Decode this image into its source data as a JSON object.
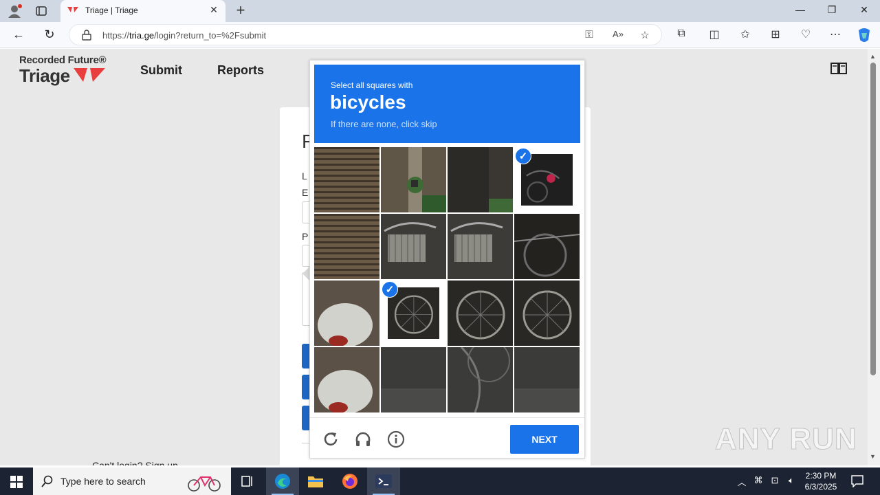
{
  "browser": {
    "tab_title": "Triage | Triage",
    "url_prefix": "https://",
    "url_host": "tria.ge",
    "url_path": "/login?return_to=%2Fsubmit"
  },
  "site": {
    "logo_line1": "Recorded Future®",
    "logo_line2": "Triage",
    "nav": [
      "Submit",
      "Reports"
    ]
  },
  "login_card": {
    "title_fragment": "F",
    "label1_fragment": "L",
    "label2_fragment": "E",
    "label3_fragment": "P",
    "bottom_links": "Can't login?       Sign up"
  },
  "captcha": {
    "instruction": "Select all squares with",
    "target": "bicycles",
    "subtext": "If there are none, click skip",
    "next_label": "NEXT",
    "tiles": [
      {
        "row": 0,
        "col": 0,
        "selected": false,
        "scene": "shutter-wall"
      },
      {
        "row": 0,
        "col": 1,
        "selected": false,
        "scene": "doorway-plant"
      },
      {
        "row": 0,
        "col": 2,
        "selected": false,
        "scene": "dark-wall"
      },
      {
        "row": 0,
        "col": 3,
        "selected": true,
        "scene": "bicycle-seat"
      },
      {
        "row": 1,
        "col": 0,
        "selected": false,
        "scene": "shutter-wall"
      },
      {
        "row": 1,
        "col": 1,
        "selected": false,
        "scene": "bicycle-basket"
      },
      {
        "row": 1,
        "col": 2,
        "selected": false,
        "scene": "bicycle-basket"
      },
      {
        "row": 1,
        "col": 3,
        "selected": false,
        "scene": "bicycles-dark"
      },
      {
        "row": 2,
        "col": 0,
        "selected": false,
        "scene": "scooter"
      },
      {
        "row": 2,
        "col": 1,
        "selected": true,
        "scene": "bicycle-wheel"
      },
      {
        "row": 2,
        "col": 2,
        "selected": false,
        "scene": "bicycle-wheel"
      },
      {
        "row": 2,
        "col": 3,
        "selected": false,
        "scene": "bicycle-wheel"
      },
      {
        "row": 3,
        "col": 0,
        "selected": false,
        "scene": "scooter"
      },
      {
        "row": 3,
        "col": 1,
        "selected": false,
        "scene": "pavement"
      },
      {
        "row": 3,
        "col": 2,
        "selected": false,
        "scene": "pavement-wheel"
      },
      {
        "row": 3,
        "col": 3,
        "selected": false,
        "scene": "pavement"
      }
    ],
    "colors": {
      "header": "#1a73e8",
      "button": "#1a73e8"
    }
  },
  "watermark": "ANY RUN",
  "taskbar": {
    "search_placeholder": "Type here to search",
    "time": "2:30 PM",
    "date": "6/3/2025"
  }
}
